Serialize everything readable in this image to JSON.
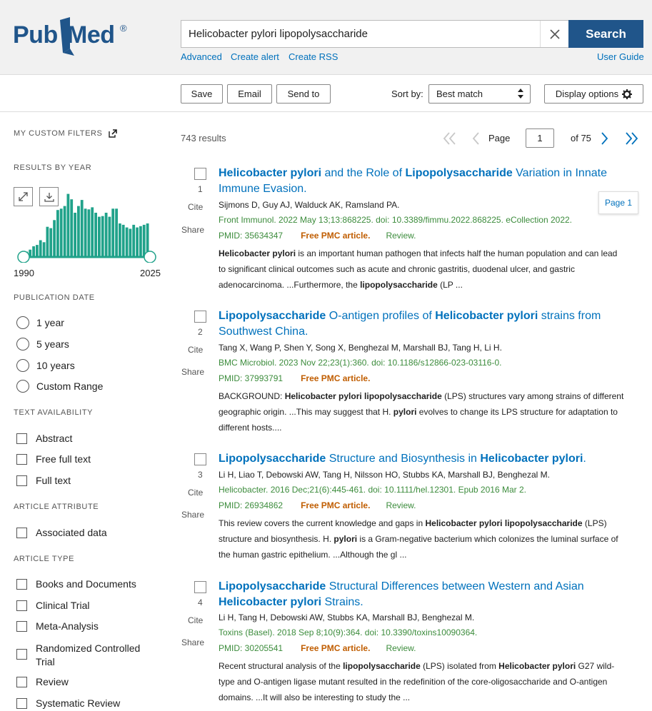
{
  "brand": {
    "name_part1": "Pub",
    "name_part2": "Med",
    "reg_mark": "®"
  },
  "search": {
    "query": "Helicobacter pylori lipopolysaccharide",
    "button_label": "Search"
  },
  "links": {
    "advanced": "Advanced",
    "create_alert": "Create alert",
    "create_rss": "Create RSS",
    "user_guide": "User Guide"
  },
  "toolbar": {
    "save": "Save",
    "email": "Email",
    "send_to": "Send to",
    "sort_by_label": "Sort by:",
    "sort_value": "Best match",
    "display_options": "Display options"
  },
  "sidebar": {
    "my_custom_filters": "MY CUSTOM FILTERS",
    "results_by_year": "RESULTS BY YEAR",
    "year_start": "1990",
    "year_end": "2025",
    "year_histogram": [
      0.08,
      0.11,
      0.16,
      0.18,
      0.25,
      0.22,
      0.45,
      0.43,
      0.55,
      0.7,
      0.72,
      0.76,
      0.94,
      0.86,
      0.66,
      0.76,
      0.85,
      0.72,
      0.71,
      0.74,
      0.66,
      0.6,
      0.61,
      0.66,
      0.6,
      0.72,
      0.72,
      0.5,
      0.48,
      0.44,
      0.42,
      0.48,
      0.44,
      0.46,
      0.48,
      0.5
    ],
    "publication_date": "PUBLICATION DATE",
    "date_options": [
      "1 year",
      "5 years",
      "10 years",
      "Custom Range"
    ],
    "text_availability": "TEXT AVAILABILITY",
    "text_options": [
      "Abstract",
      "Free full text",
      "Full text"
    ],
    "article_attribute": "ARTICLE ATTRIBUTE",
    "attribute_options": [
      "Associated data"
    ],
    "article_type": "ARTICLE TYPE",
    "type_options": [
      "Books and Documents",
      "Clinical Trial",
      "Meta-Analysis",
      "Randomized Controlled Trial",
      "Review",
      "Systematic Review"
    ]
  },
  "results_meta": {
    "count": "743 results",
    "page_label": "Page",
    "page_value": "1",
    "of_pages": "of 75",
    "page_badge": "Page 1"
  },
  "labels": {
    "cite": "Cite",
    "share": "Share",
    "free_pmc": "Free PMC article.",
    "review": "Review."
  },
  "results": [
    {
      "num": "1",
      "title_parts": [
        {
          "t": "Helicobacter pylori",
          "b": true
        },
        {
          "t": " and the Role of ",
          "b": false
        },
        {
          "t": "Lipopolysaccharide",
          "b": true
        },
        {
          "t": " Variation in Innate Immune Evasion.",
          "b": false
        }
      ],
      "authors": "Sijmons D, Guy AJ, Walduck AK, Ramsland PA.",
      "citation": "Front Immunol. 2022 May 13;13:868225. doi: 10.3389/fimmu.2022.868225. eCollection 2022.",
      "pmid": "PMID: 35634347",
      "snippet_parts": [
        {
          "t": "Helicobacter pylori",
          "b": true
        },
        {
          "t": " is an important human pathogen that infects half the human population and can lead to significant clinical outcomes such as acute and chronic gastritis, duodenal ulcer, and gastric adenocarcinoma. ...Furthermore, the ",
          "b": false
        },
        {
          "t": "lipopolysaccharide",
          "b": true
        },
        {
          "t": " (LP ...",
          "b": false
        }
      ]
    },
    {
      "num": "2",
      "title_parts": [
        {
          "t": "Lipopolysaccharide",
          "b": true
        },
        {
          "t": " O-antigen profiles of ",
          "b": false
        },
        {
          "t": "Helicobacter pylori",
          "b": true
        },
        {
          "t": " strains from Southwest China.",
          "b": false
        }
      ],
      "authors": "Tang X, Wang P, Shen Y, Song X, Benghezal M, Marshall BJ, Tang H, Li H.",
      "citation": "BMC Microbiol. 2023 Nov 22;23(1):360. doi: 10.1186/s12866-023-03116-0.",
      "pmid": "PMID: 37993791",
      "snippet_parts": [
        {
          "t": "BACKGROUND: ",
          "b": false
        },
        {
          "t": "Helicobacter pylori lipopolysaccharide",
          "b": true
        },
        {
          "t": " (LPS) structures vary among strains of different geographic origin. ...This may suggest that H. ",
          "b": false
        },
        {
          "t": "pylori",
          "b": true
        },
        {
          "t": " evolves to change its LPS structure for adaptation to different hosts....",
          "b": false
        }
      ]
    },
    {
      "num": "3",
      "title_parts": [
        {
          "t": "Lipopolysaccharide",
          "b": true
        },
        {
          "t": " Structure and Biosynthesis in ",
          "b": false
        },
        {
          "t": "Helicobacter pylori",
          "b": true
        },
        {
          "t": ".",
          "b": false
        }
      ],
      "authors": "Li H, Liao T, Debowski AW, Tang H, Nilsson HO, Stubbs KA, Marshall BJ, Benghezal M.",
      "citation": "Helicobacter. 2016 Dec;21(6):445-461. doi: 10.1111/hel.12301. Epub 2016 Mar 2.",
      "pmid": "PMID: 26934862",
      "snippet_parts": [
        {
          "t": "This review covers the current knowledge and gaps in ",
          "b": false
        },
        {
          "t": "Helicobacter pylori lipopolysaccharide",
          "b": true
        },
        {
          "t": " (LPS) structure and biosynthesis. H. ",
          "b": false
        },
        {
          "t": "pylori",
          "b": true
        },
        {
          "t": " is a Gram-negative bacterium which colonizes the luminal surface of the human gastric epithelium. ...Although the gl ...",
          "b": false
        }
      ]
    },
    {
      "num": "4",
      "title_parts": [
        {
          "t": "Lipopolysaccharide",
          "b": true
        },
        {
          "t": " Structural Differences between Western and Asian ",
          "b": false
        },
        {
          "t": "Helicobacter pylori",
          "b": true
        },
        {
          "t": " Strains.",
          "b": false
        }
      ],
      "authors": "Li H, Tang H, Debowski AW, Stubbs KA, Marshall BJ, Benghezal M.",
      "citation": "Toxins (Basel). 2018 Sep 8;10(9):364. doi: 10.3390/toxins10090364.",
      "pmid": "PMID: 30205541",
      "snippet_parts": [
        {
          "t": "Recent structural analysis of the ",
          "b": false
        },
        {
          "t": "lipopolysaccharide",
          "b": true
        },
        {
          "t": " (LPS) isolated from ",
          "b": false
        },
        {
          "t": "Helicobacter pylori",
          "b": true
        },
        {
          "t": " G27 wild-type and O-antigen ligase mutant resulted in the redefinition of the core-oligosaccharide and O-antigen domains. ...It will also be interesting to study the ...",
          "b": false
        }
      ]
    }
  ]
}
